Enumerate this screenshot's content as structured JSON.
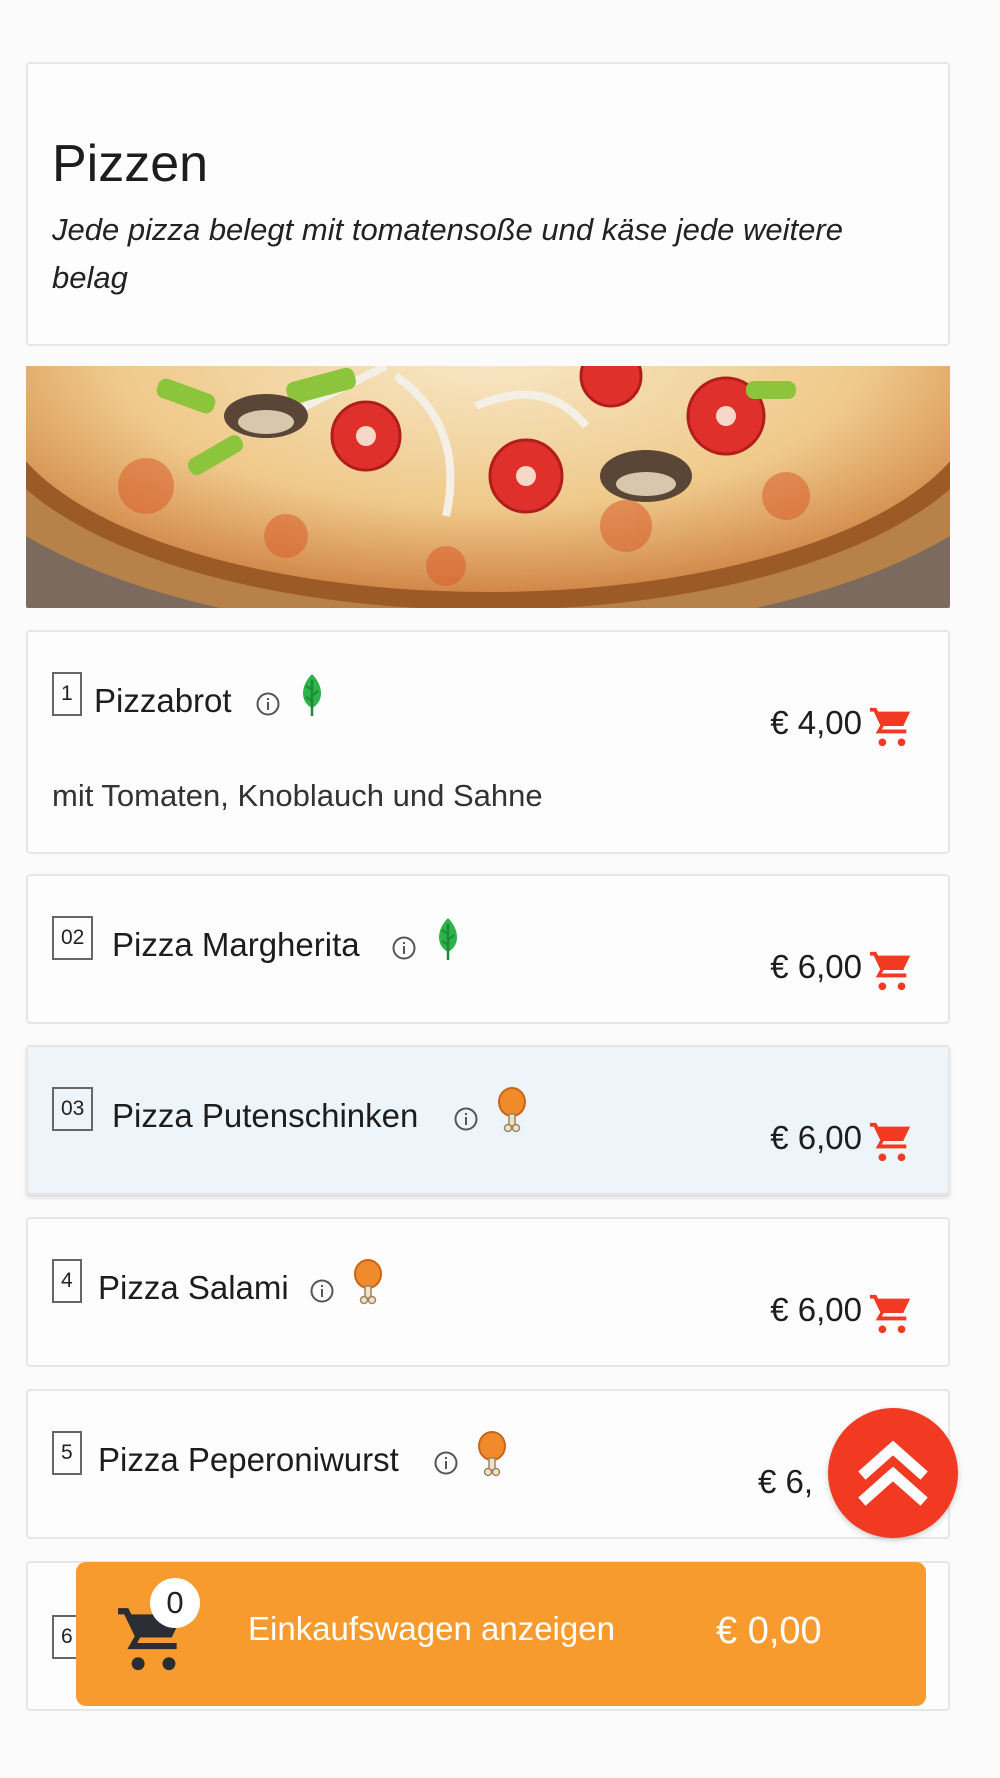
{
  "category": {
    "title": "Pizzen",
    "description": "Jede pizza belegt mit tomatensoße und käse jede weitere belag"
  },
  "items": [
    {
      "number": "1",
      "name": "Pizzabrot",
      "price": "€ 4,00",
      "diet": "vegetarian-leaf-icon",
      "description": "mit Tomaten, Knoblauch und Sahne"
    },
    {
      "number": "02",
      "name": "Pizza Margherita",
      "price": "€ 6,00",
      "diet": "vegetarian-leaf-icon"
    },
    {
      "number": "03",
      "name": "Pizza Putenschinken",
      "price": "€ 6,00",
      "diet": "meat-drumstick-icon"
    },
    {
      "number": "4",
      "name": "Pizza Salami",
      "price": "€ 6,00",
      "diet": "meat-drumstick-icon"
    },
    {
      "number": "5",
      "name": "Pizza Peperoniwurst",
      "price": "€ 6,",
      "diet": "meat-drumstick-icon"
    },
    {
      "number": "6"
    }
  ],
  "cart": {
    "count": "0",
    "label": "Einkaufswagen anzeigen",
    "total": "€ 0,00"
  },
  "colors": {
    "accent_red": "#f23a22",
    "cart_orange": "#f89b2e",
    "veg_green": "#2db34a",
    "meat_orange": "#f08a2a",
    "active_row": "#eef5fa"
  }
}
